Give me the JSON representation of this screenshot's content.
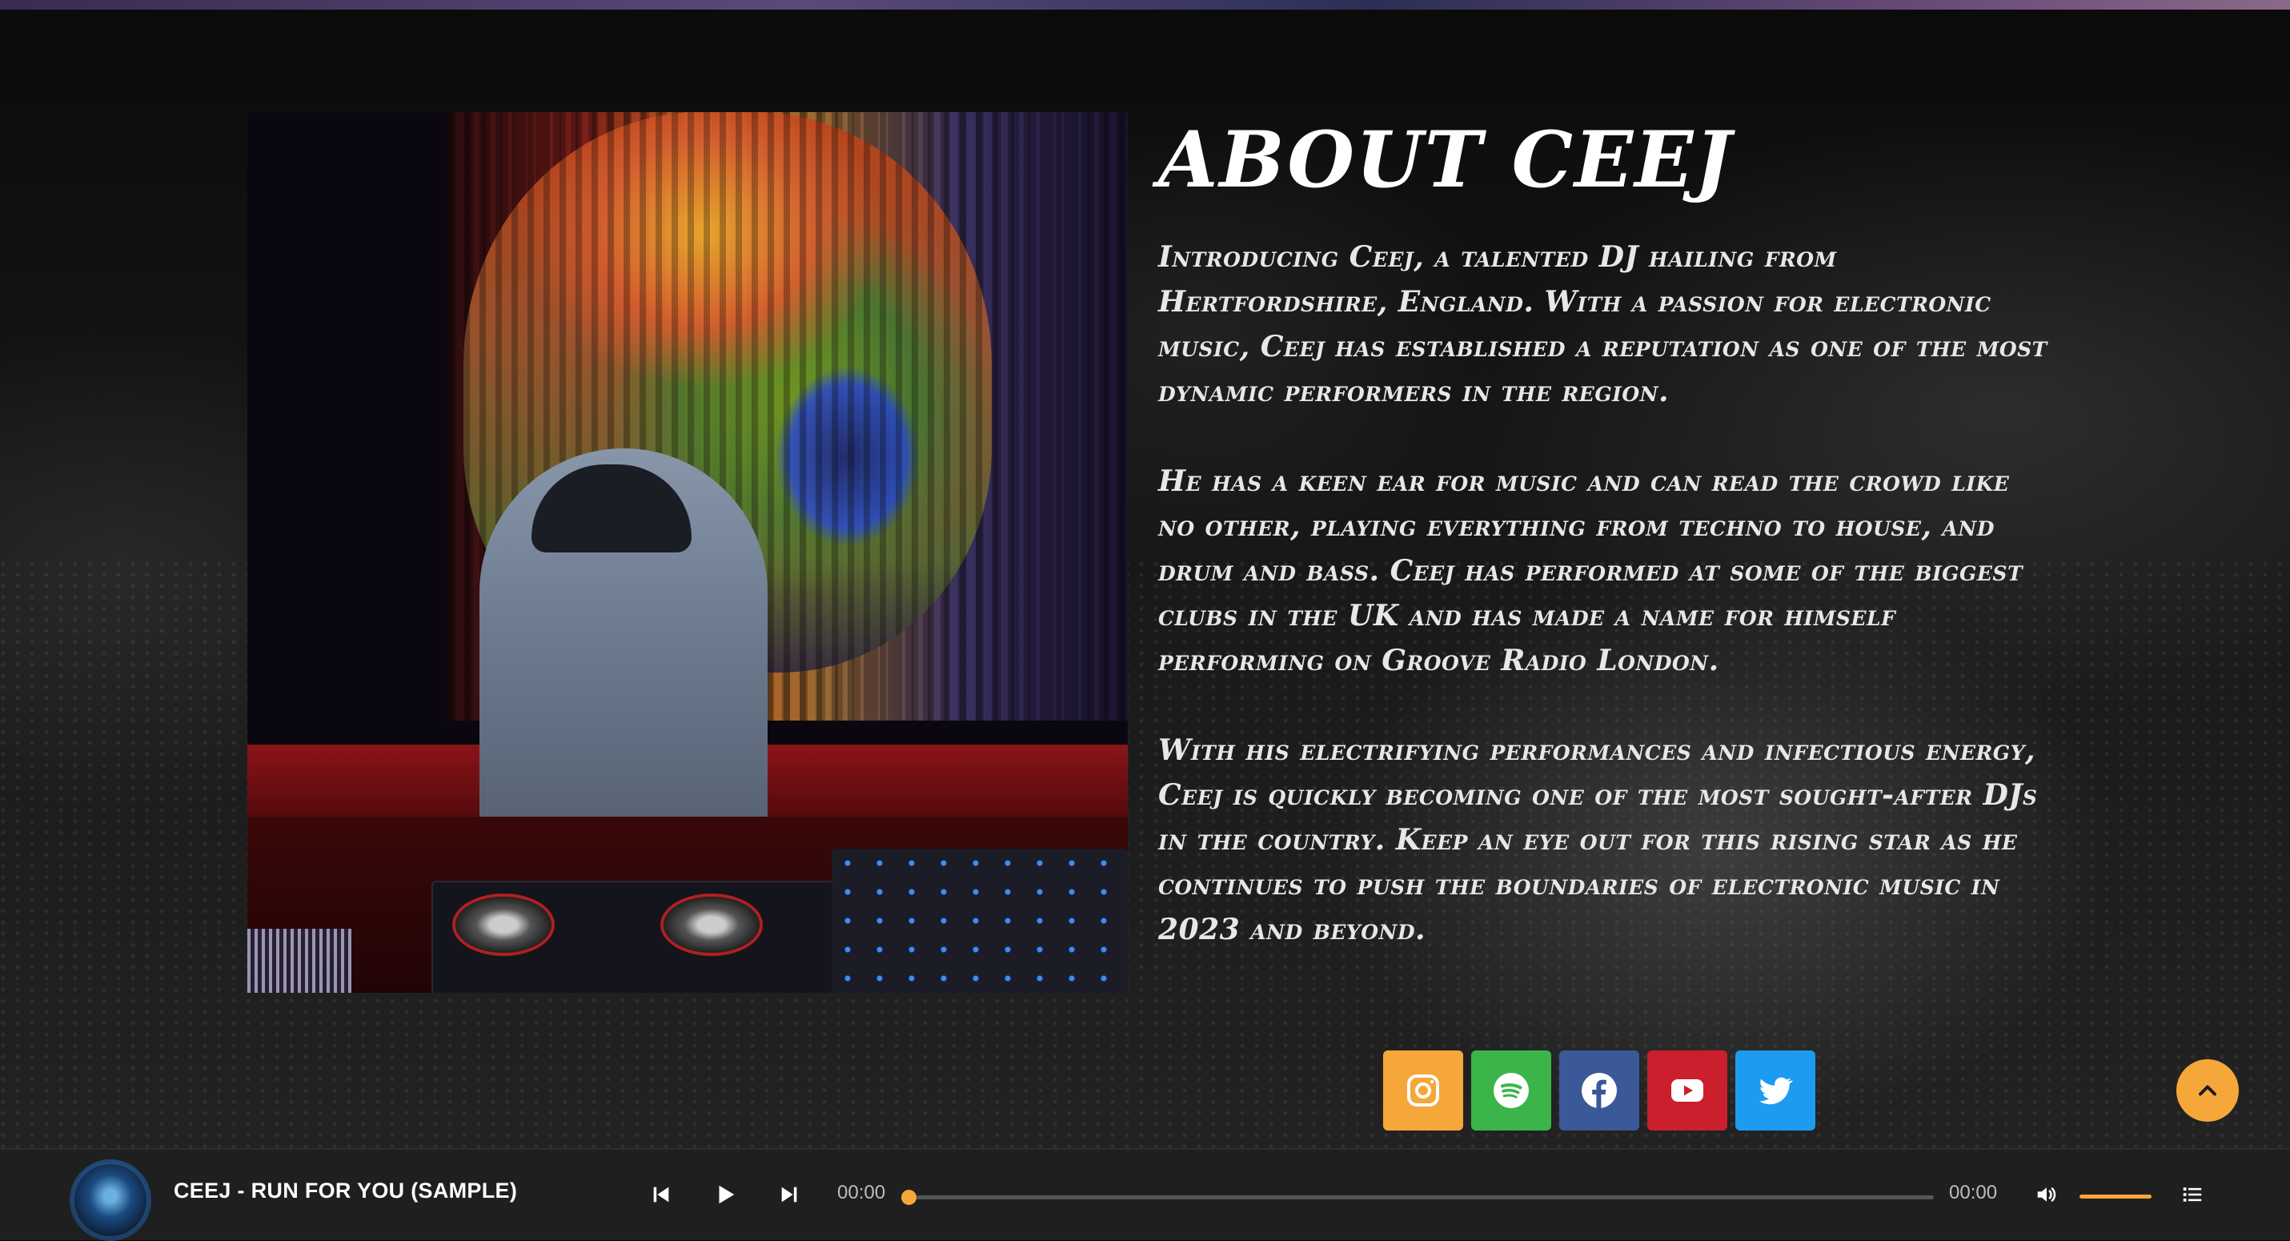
{
  "about": {
    "title": "ABOUT CEEJ",
    "paragraphs": [
      "Introducing Ceej, a talented DJ hailing from Hertfordshire, England. With a passion for electronic music, Ceej has established a reputation as one of the most dynamic performers in the region.",
      "He has a keen ear for music and can read the crowd like no other, playing everything from techno to house, and drum and bass. Ceej has performed at some of the biggest clubs in the UK and has made a name for himself performing on Groove Radio London.",
      "With his electrifying performances and infectious energy, Ceej is quickly becoming one of the most sought-after DJs in the country. Keep an eye out for this rising star as he continues to push the boundaries of electronic music in 2023 and beyond."
    ],
    "photo_icon": "dj-performer-photo"
  },
  "social": [
    {
      "name": "instagram",
      "icon": "instagram-icon",
      "color": "#f6a73a"
    },
    {
      "name": "spotify",
      "icon": "spotify-icon",
      "color": "#3bb54a"
    },
    {
      "name": "facebook",
      "icon": "facebook-icon",
      "color": "#3b5998"
    },
    {
      "name": "youtube",
      "icon": "youtube-icon",
      "color": "#cc1f2d"
    },
    {
      "name": "twitter",
      "icon": "twitter-icon",
      "color": "#1d9bf0"
    }
  ],
  "back_to_top": {
    "icon": "chevron-up-icon",
    "color": "#f6a73a"
  },
  "player": {
    "track_title": "CEEJ - RUN FOR YOU (SAMPLE)",
    "current_time": "00:00",
    "duration": "00:00",
    "progress_fraction": 0,
    "volume_fraction": 1,
    "accent": "#f6a73a",
    "icons": [
      "prev-icon",
      "play-icon",
      "next-icon",
      "volume-icon",
      "playlist-icon"
    ]
  }
}
